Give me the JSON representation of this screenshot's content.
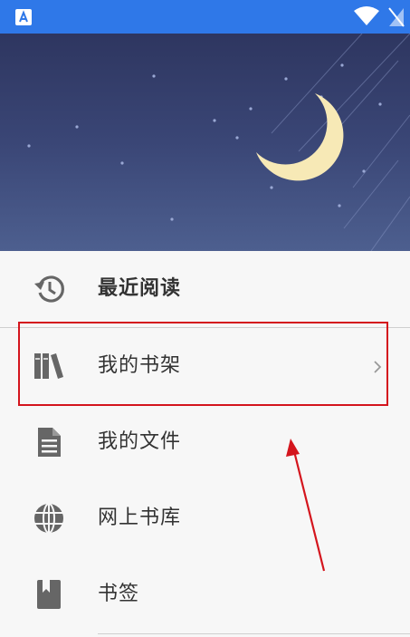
{
  "menu": {
    "items": [
      {
        "label": "最近阅读",
        "icon": "history-icon"
      },
      {
        "label": "我的书架",
        "icon": "bookshelf-icon"
      },
      {
        "label": "我的文件",
        "icon": "file-icon"
      },
      {
        "label": "网上书库",
        "icon": "globe-icon"
      },
      {
        "label": "书签",
        "icon": "bookmark-icon"
      }
    ]
  },
  "colors": {
    "status_bar": "#2f78e8",
    "header_top": "#2e3660",
    "header_bottom": "#4d5f8f",
    "moon": "#f7e9b6",
    "highlight": "#d4151d",
    "icon_gray": "#666666"
  }
}
